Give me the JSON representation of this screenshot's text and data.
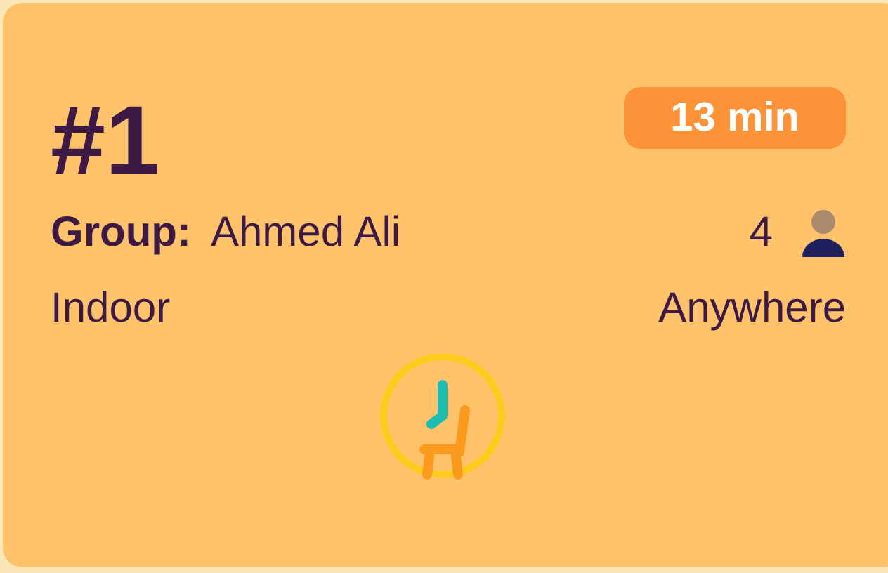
{
  "card": {
    "number": "#1",
    "wait_time": "13 min",
    "group_label": "Group:",
    "group_name": "Ahmed Ali",
    "party_size": "4",
    "seating": "Indoor",
    "location": "Anywhere"
  }
}
